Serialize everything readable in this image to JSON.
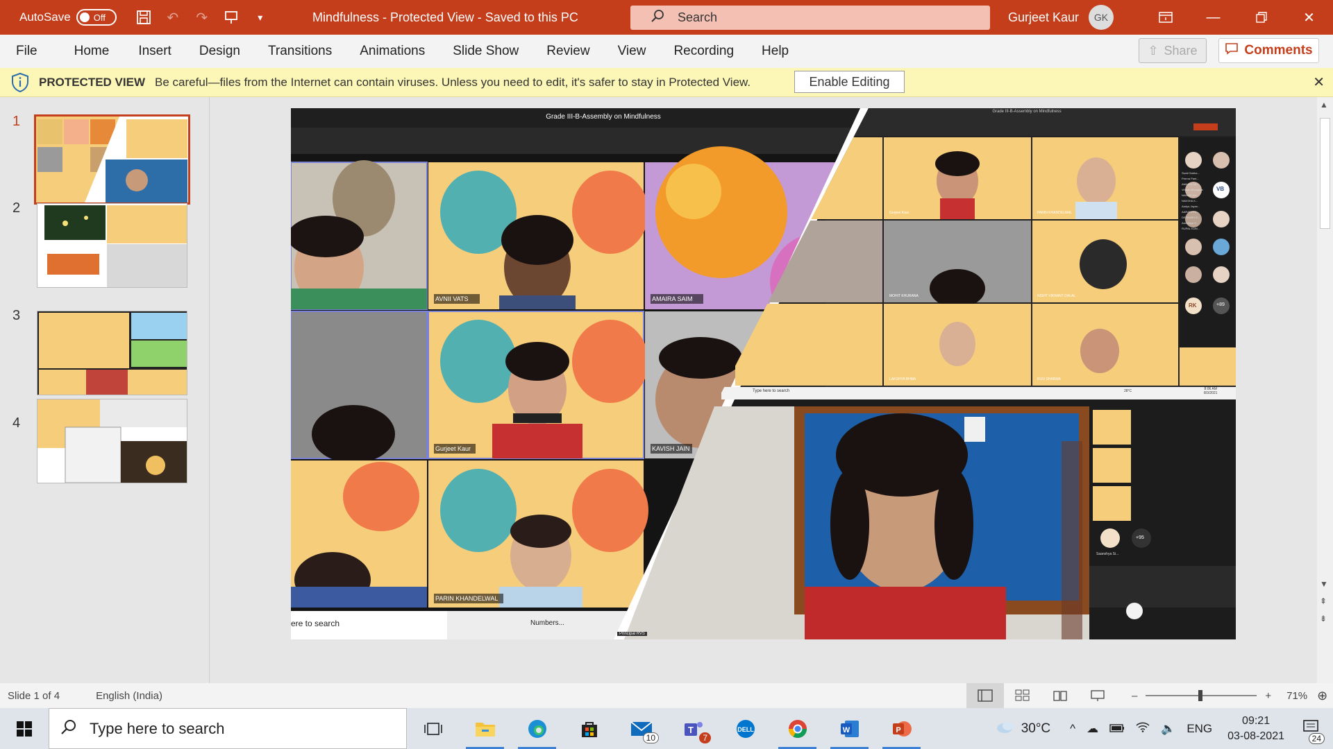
{
  "titlebar": {
    "autosave_label": "AutoSave",
    "autosave_state": "Off",
    "document_title": "Mindfulness  -  Protected View  -  Saved to this PC",
    "search_placeholder": "Search",
    "user_name": "Gurjeet Kaur",
    "user_initials": "GK",
    "accent_color": "#c43e1c"
  },
  "menu": {
    "items": [
      "File",
      "Home",
      "Insert",
      "Design",
      "Transitions",
      "Animations",
      "Slide Show",
      "Review",
      "View",
      "Recording",
      "Help"
    ],
    "share_label": "Share",
    "comments_label": "Comments"
  },
  "protected_view": {
    "title": "PROTECTED VIEW",
    "message": "Be careful—files from the Internet can contain viruses. Unless you need to edit, it's safer to stay in Protected View.",
    "button_label": "Enable Editing"
  },
  "thumbnails": [
    {
      "number": "1",
      "active": true
    },
    {
      "number": "2",
      "active": false
    },
    {
      "number": "3",
      "active": false
    },
    {
      "number": "4",
      "active": false
    }
  ],
  "slide": {
    "meeting_title_left": "Grade III-B-Assembly on Mindfulness",
    "meeting_title_right": "Grade III-B-Assembly on Mindfulness",
    "participants_left": [
      "AVNII VATS",
      "AMAIRA SAIM",
      "Gurjeet Kaur",
      "KAVISH JAIN",
      "PARIN KHANDELWAL"
    ],
    "taskbar_search_left": "ere to search",
    "taskbar_app_left": "Numbers...",
    "presenter_label": "Principal RVS",
    "grid_right_labels": [
      "Gurjeet Kaur",
      "PARIN KHANDELWAL",
      "MOHIT KHURANA",
      "NISHT VIKRANT DALAL",
      "LAKSHYA BHMA",
      "RIJU SHARMA"
    ],
    "side_names": [
      "Swati Sabha...",
      "Prerna Pant...",
      "AMAIRA SA...",
      "Vihaan Bhargava",
      "NAMAN KH...",
      "NAKSHA K...",
      "Aadya Jayan...",
      "AARADHYA...",
      "DEVANSH S...",
      "Aaradhya S...",
      "RUPAL KUM..."
    ],
    "side_initials_vb": "VB",
    "side_initials_rk": "RK",
    "more_count": "+89",
    "more_count2": "+95",
    "saanshya_label": "Saanshya Si...",
    "mini_taskbar_search": "Type here to search",
    "mini_temp": "28°C",
    "mini_time": "8:06 AM",
    "mini_date": "8/3/2021"
  },
  "statusbar": {
    "slide_info": "Slide 1 of 4",
    "language": "English (India)",
    "zoom_minus": "–",
    "zoom_plus": "+",
    "zoom_level": "71%"
  },
  "taskbar": {
    "search_placeholder": "Type here to search",
    "mail_badge": "10",
    "teams_badge": "7",
    "temperature": "30°C",
    "language": "ENG",
    "time": "09:21",
    "date": "03-08-2021",
    "notifications": "24"
  }
}
